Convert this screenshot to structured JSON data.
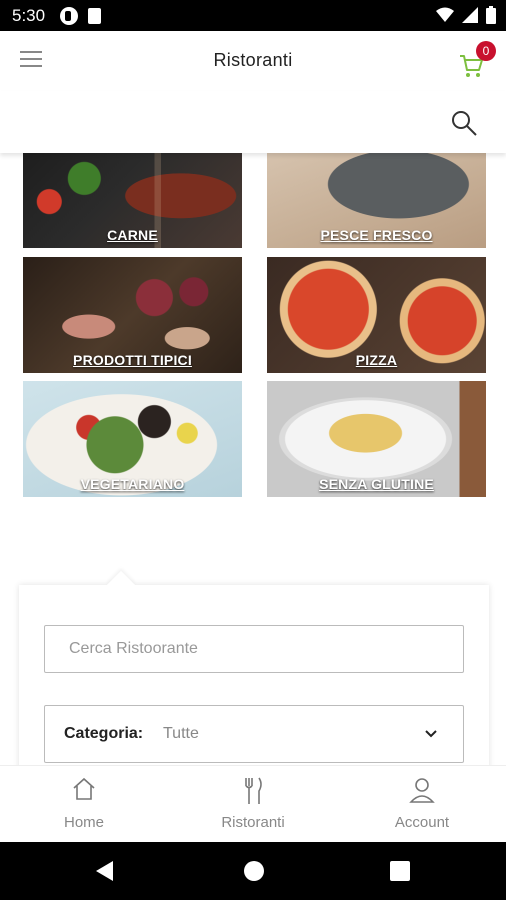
{
  "status_bar": {
    "time": "5:30",
    "icons": [
      "notification-icon",
      "sim-card-icon",
      "wifi-icon",
      "signal-icon",
      "battery-icon"
    ]
  },
  "app_bar": {
    "title": "Ristoranti",
    "cart_count": "0",
    "icons": [
      "menu-icon",
      "cart-icon",
      "search-icon"
    ]
  },
  "colors": {
    "accent": "#c8102e",
    "cart_green": "#7dbf3f",
    "muted_text": "#888888"
  },
  "categories": [
    {
      "label": "CARNE",
      "image": "grilled-steak-vegetables"
    },
    {
      "label": "PESCE FRESCO",
      "image": "fresh-fish"
    },
    {
      "label": "PRODOTTI TIPICI",
      "image": "cured-meats-board"
    },
    {
      "label": "PIZZA",
      "image": "margherita-pizzas"
    },
    {
      "label": "VEGETARIANO",
      "image": "salad-bowl"
    },
    {
      "label": "SENZA GLUTINE",
      "image": "penne-pasta-plate"
    }
  ],
  "search_panel": {
    "input_placeholder": "Cerca Ristoorante",
    "category_label": "Categoria:",
    "category_value": "Tutte"
  },
  "bottom_nav": [
    {
      "label": "Home",
      "icon": "home-icon"
    },
    {
      "label": "Ristoranti",
      "icon": "fork-knife-icon"
    },
    {
      "label": "Account",
      "icon": "user-icon"
    }
  ],
  "system_nav": [
    "back-button",
    "home-button",
    "recents-button"
  ]
}
